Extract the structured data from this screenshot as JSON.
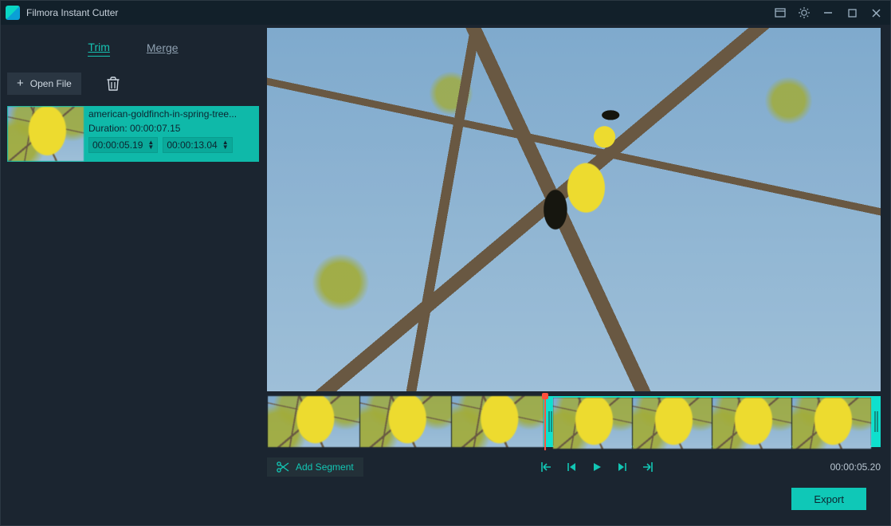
{
  "window": {
    "title": "Filmora Instant Cutter"
  },
  "tabs": {
    "trim": "Trim",
    "merge": "Merge",
    "active": "trim"
  },
  "toolbar": {
    "open_label": "Open File"
  },
  "clip": {
    "name": "american-goldfinch-in-spring-tree...",
    "duration_label": "Duration: 00:00:07.15",
    "in_time": "00:00:05.19",
    "out_time": "00:00:13.04"
  },
  "controls": {
    "add_segment": "Add Segment",
    "current_time": "00:00:05.20"
  },
  "footer": {
    "export": "Export"
  },
  "icons": {
    "trash": "trash-icon",
    "scissors": "scissors-icon",
    "set_in": "set-in-icon",
    "prev_frame": "previous-frame-icon",
    "play": "play-icon",
    "next_frame": "next-frame-icon",
    "set_out": "set-out-icon"
  },
  "colors": {
    "accent": "#0fc8b7",
    "bg": "#1b2530",
    "titlebar": "#12202a"
  }
}
